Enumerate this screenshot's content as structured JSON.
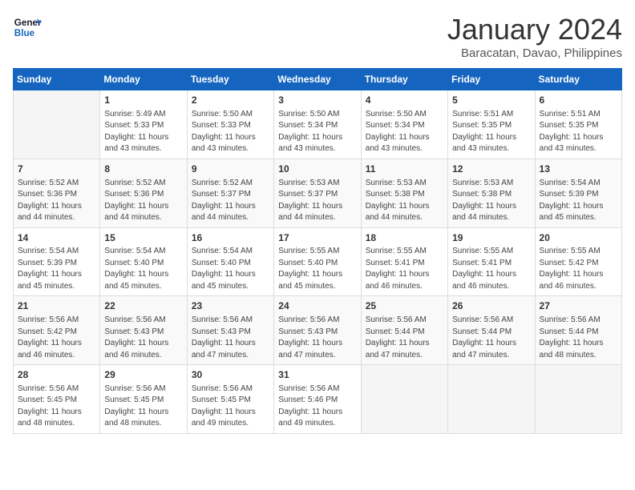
{
  "logo": {
    "line1": "General",
    "line2": "Blue"
  },
  "title": "January 2024",
  "location": "Baracatan, Davao, Philippines",
  "days_of_week": [
    "Sunday",
    "Monday",
    "Tuesday",
    "Wednesday",
    "Thursday",
    "Friday",
    "Saturday"
  ],
  "weeks": [
    [
      {
        "day": "",
        "info": ""
      },
      {
        "day": "1",
        "info": "Sunrise: 5:49 AM\nSunset: 5:33 PM\nDaylight: 11 hours\nand 43 minutes."
      },
      {
        "day": "2",
        "info": "Sunrise: 5:50 AM\nSunset: 5:33 PM\nDaylight: 11 hours\nand 43 minutes."
      },
      {
        "day": "3",
        "info": "Sunrise: 5:50 AM\nSunset: 5:34 PM\nDaylight: 11 hours\nand 43 minutes."
      },
      {
        "day": "4",
        "info": "Sunrise: 5:50 AM\nSunset: 5:34 PM\nDaylight: 11 hours\nand 43 minutes."
      },
      {
        "day": "5",
        "info": "Sunrise: 5:51 AM\nSunset: 5:35 PM\nDaylight: 11 hours\nand 43 minutes."
      },
      {
        "day": "6",
        "info": "Sunrise: 5:51 AM\nSunset: 5:35 PM\nDaylight: 11 hours\nand 43 minutes."
      }
    ],
    [
      {
        "day": "7",
        "info": "Sunrise: 5:52 AM\nSunset: 5:36 PM\nDaylight: 11 hours\nand 44 minutes."
      },
      {
        "day": "8",
        "info": "Sunrise: 5:52 AM\nSunset: 5:36 PM\nDaylight: 11 hours\nand 44 minutes."
      },
      {
        "day": "9",
        "info": "Sunrise: 5:52 AM\nSunset: 5:37 PM\nDaylight: 11 hours\nand 44 minutes."
      },
      {
        "day": "10",
        "info": "Sunrise: 5:53 AM\nSunset: 5:37 PM\nDaylight: 11 hours\nand 44 minutes."
      },
      {
        "day": "11",
        "info": "Sunrise: 5:53 AM\nSunset: 5:38 PM\nDaylight: 11 hours\nand 44 minutes."
      },
      {
        "day": "12",
        "info": "Sunrise: 5:53 AM\nSunset: 5:38 PM\nDaylight: 11 hours\nand 44 minutes."
      },
      {
        "day": "13",
        "info": "Sunrise: 5:54 AM\nSunset: 5:39 PM\nDaylight: 11 hours\nand 45 minutes."
      }
    ],
    [
      {
        "day": "14",
        "info": "Sunrise: 5:54 AM\nSunset: 5:39 PM\nDaylight: 11 hours\nand 45 minutes."
      },
      {
        "day": "15",
        "info": "Sunrise: 5:54 AM\nSunset: 5:40 PM\nDaylight: 11 hours\nand 45 minutes."
      },
      {
        "day": "16",
        "info": "Sunrise: 5:54 AM\nSunset: 5:40 PM\nDaylight: 11 hours\nand 45 minutes."
      },
      {
        "day": "17",
        "info": "Sunrise: 5:55 AM\nSunset: 5:40 PM\nDaylight: 11 hours\nand 45 minutes."
      },
      {
        "day": "18",
        "info": "Sunrise: 5:55 AM\nSunset: 5:41 PM\nDaylight: 11 hours\nand 46 minutes."
      },
      {
        "day": "19",
        "info": "Sunrise: 5:55 AM\nSunset: 5:41 PM\nDaylight: 11 hours\nand 46 minutes."
      },
      {
        "day": "20",
        "info": "Sunrise: 5:55 AM\nSunset: 5:42 PM\nDaylight: 11 hours\nand 46 minutes."
      }
    ],
    [
      {
        "day": "21",
        "info": "Sunrise: 5:56 AM\nSunset: 5:42 PM\nDaylight: 11 hours\nand 46 minutes."
      },
      {
        "day": "22",
        "info": "Sunrise: 5:56 AM\nSunset: 5:43 PM\nDaylight: 11 hours\nand 46 minutes."
      },
      {
        "day": "23",
        "info": "Sunrise: 5:56 AM\nSunset: 5:43 PM\nDaylight: 11 hours\nand 47 minutes."
      },
      {
        "day": "24",
        "info": "Sunrise: 5:56 AM\nSunset: 5:43 PM\nDaylight: 11 hours\nand 47 minutes."
      },
      {
        "day": "25",
        "info": "Sunrise: 5:56 AM\nSunset: 5:44 PM\nDaylight: 11 hours\nand 47 minutes."
      },
      {
        "day": "26",
        "info": "Sunrise: 5:56 AM\nSunset: 5:44 PM\nDaylight: 11 hours\nand 47 minutes."
      },
      {
        "day": "27",
        "info": "Sunrise: 5:56 AM\nSunset: 5:44 PM\nDaylight: 11 hours\nand 48 minutes."
      }
    ],
    [
      {
        "day": "28",
        "info": "Sunrise: 5:56 AM\nSunset: 5:45 PM\nDaylight: 11 hours\nand 48 minutes."
      },
      {
        "day": "29",
        "info": "Sunrise: 5:56 AM\nSunset: 5:45 PM\nDaylight: 11 hours\nand 48 minutes."
      },
      {
        "day": "30",
        "info": "Sunrise: 5:56 AM\nSunset: 5:45 PM\nDaylight: 11 hours\nand 49 minutes."
      },
      {
        "day": "31",
        "info": "Sunrise: 5:56 AM\nSunset: 5:46 PM\nDaylight: 11 hours\nand 49 minutes."
      },
      {
        "day": "",
        "info": ""
      },
      {
        "day": "",
        "info": ""
      },
      {
        "day": "",
        "info": ""
      }
    ]
  ]
}
